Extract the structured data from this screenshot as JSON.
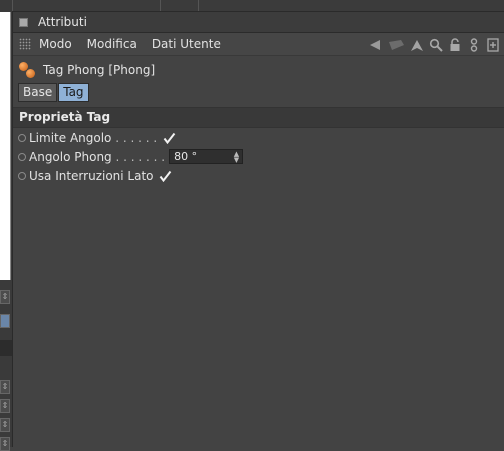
{
  "window": {
    "title": "Attributi"
  },
  "menu": {
    "items": [
      "Modo",
      "Modifica",
      "Dati Utente"
    ]
  },
  "toolbar": {
    "icons": [
      "arrow-left-icon",
      "arrow-right-icon",
      "arrow-up-icon",
      "search-icon",
      "lock-icon",
      "link-icon",
      "new-panel-icon"
    ]
  },
  "object": {
    "name": "Tag Phong [Phong]",
    "icon": "phong-tag-icon"
  },
  "tabs": [
    {
      "label": "Base",
      "active": false
    },
    {
      "label": "Tag",
      "active": true
    }
  ],
  "section": {
    "title": "Proprietà Tag"
  },
  "properties": [
    {
      "label": "Limite Angolo",
      "dots": " . . . . . .",
      "type": "checkbox",
      "checked": true
    },
    {
      "label": "Angolo Phong",
      "dots": " . . . . . . .",
      "type": "number",
      "value": "80 °"
    },
    {
      "label": "Usa Interruzioni Lato",
      "dots": "",
      "type": "checkbox",
      "checked": true
    }
  ],
  "colors": {
    "panel": "#434343",
    "tab_active": "#8fb1d6",
    "header": "#393939"
  }
}
